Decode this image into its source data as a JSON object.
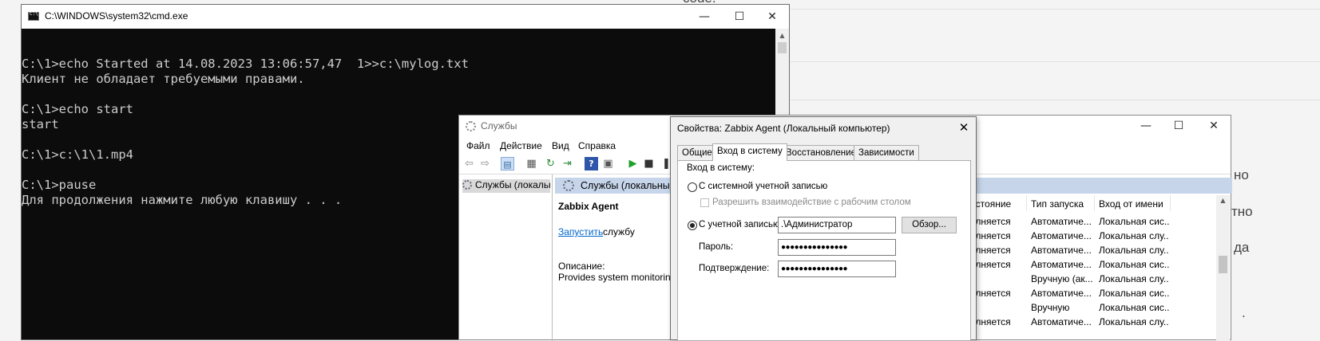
{
  "background_page": {
    "fragments": [
      "code.",
      "но",
      "тно",
      "да",
      "."
    ]
  },
  "cmd": {
    "title": "C:\\WINDOWS\\system32\\cmd.exe",
    "minimize": "—",
    "maximize": "☐",
    "close": "✕",
    "scroll_up": "▲",
    "output": "\nC:\\1>echo Started at 14.08.2023 13:06:57,47  1>>c:\\mylog.txt\nКлиент не обладает требуемыми правами.\n\nC:\\1>echo start\nstart\n\nC:\\1>c:\\1\\1.mp4\n\nC:\\1>pause\nДля продолжения нажмите любую клавишу . . ."
  },
  "services": {
    "title": "Службы",
    "minimize": "—",
    "maximize": "☐",
    "close": "✕",
    "menu": [
      "Файл",
      "Действие",
      "Вид",
      "Справка"
    ],
    "toolbar_icons": [
      "back-arrow-icon",
      "forward-arrow-icon",
      "console-tree-icon",
      "properties-icon",
      "refresh-icon",
      "export-icon",
      "help-icon",
      "view-icon",
      "play-icon",
      "stop-icon",
      "pause-icon"
    ],
    "tree_item": "Службы (локальные)",
    "detail_header": "Службы (локальные)",
    "service_name": "Zabbix Agent",
    "start_link": "Запустить",
    "start_rest": "службу",
    "description_label": "Описание:",
    "description_value": "Provides system monitoring",
    "columns": [
      "остояние",
      "Тип запуска",
      "Вход от имени"
    ],
    "rows": [
      [
        "олняется",
        "Автоматиче...",
        "Локальная сис..."
      ],
      [
        "олняется",
        "Автоматиче...",
        "Локальная слу..."
      ],
      [
        "олняется",
        "Автоматиче...",
        "Локальная слу..."
      ],
      [
        "олняется",
        "Автоматиче...",
        "Локальная сис..."
      ],
      [
        "",
        "Вручную (ак...",
        "Локальная слу..."
      ],
      [
        "олняется",
        "Автоматиче...",
        "Локальная сис..."
      ],
      [
        "",
        "Вручную",
        "Локальная сис..."
      ],
      [
        "олняется",
        "Автоматиче...",
        "Локальная слу..."
      ]
    ],
    "scroll_up": "▲"
  },
  "dialog": {
    "title": "Свойства: Zabbix Agent (Локальный компьютер)",
    "close": "✕",
    "tabs": [
      "Общие",
      "Вход в систему",
      "Восстановление",
      "Зависимости"
    ],
    "active_tab": "Вход в систему",
    "group_label": "Вход в систему:",
    "radio_system": "С системной учетной записью",
    "checkbox_desktop": "Разрешить взаимодействие с рабочим столом",
    "radio_account": "С учетной записью:",
    "account_value": ".\\Администратор",
    "browse_button": "Обзор...",
    "password_label": "Пароль:",
    "password_value": "●●●●●●●●●●●●●●●",
    "confirm_label": "Подтверждение:",
    "confirm_value": "●●●●●●●●●●●●●●●"
  }
}
